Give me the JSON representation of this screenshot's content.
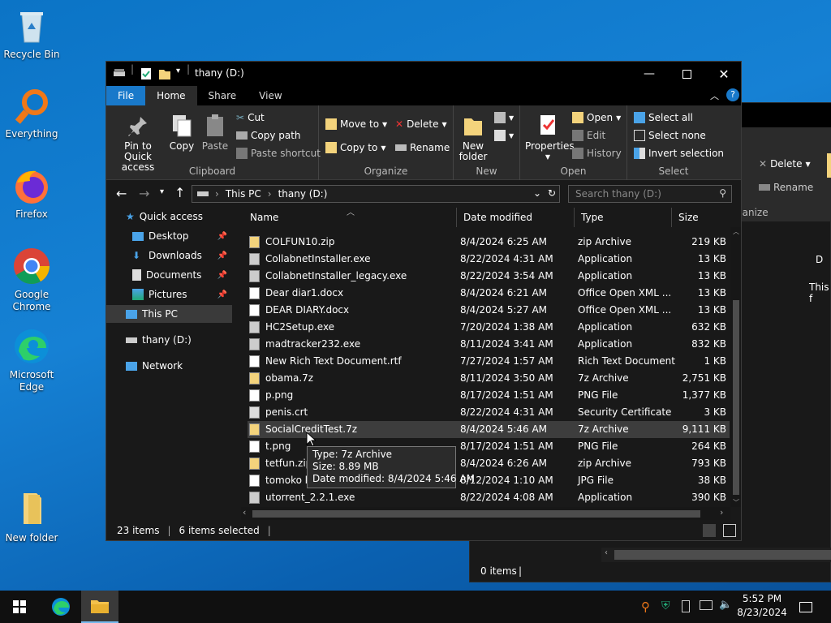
{
  "desktop": {
    "icons": [
      {
        "label": "Recycle Bin"
      },
      {
        "label": "Everything"
      },
      {
        "label": "Firefox"
      },
      {
        "label": "Google Chrome"
      },
      {
        "label": "Microsoft Edge"
      },
      {
        "label": "New folder"
      }
    ]
  },
  "window": {
    "title": "thany (D:)",
    "tabs": [
      "File",
      "Home",
      "Share",
      "View"
    ],
    "ribbon": {
      "clipboard": {
        "label": "Clipboard",
        "pin": "Pin to Quick access",
        "copy": "Copy",
        "paste": "Paste",
        "cut": "Cut",
        "copy_path": "Copy path",
        "paste_shortcut": "Paste shortcut"
      },
      "organize": {
        "label": "Organize",
        "move_to": "Move to",
        "copy_to": "Copy to",
        "delete": "Delete",
        "rename": "Rename"
      },
      "new": {
        "label": "New",
        "new_folder": "New folder"
      },
      "open": {
        "label": "Open",
        "properties": "Properties",
        "open": "Open",
        "edit": "Edit",
        "history": "History"
      },
      "select": {
        "label": "Select",
        "select_all": "Select all",
        "select_none": "Select none",
        "invert": "Invert selection"
      }
    },
    "address": {
      "crumbs": [
        "This PC",
        "thany (D:)"
      ]
    },
    "search": {
      "placeholder": "Search thany (D:)"
    },
    "nav": {
      "quick_access": "Quick access",
      "items": [
        "Desktop",
        "Downloads",
        "Documents",
        "Pictures"
      ],
      "this_pc": "This PC",
      "drive": "thany (D:)",
      "network": "Network"
    },
    "columns": {
      "name": "Name",
      "date": "Date modified",
      "type": "Type",
      "size": "Size"
    },
    "files": [
      {
        "name": "COLFUN10.zip",
        "date": "8/4/2024 6:25 AM",
        "type": "zip Archive",
        "size": "219 KB"
      },
      {
        "name": "CollabnetInstaller.exe",
        "date": "8/22/2024 4:31 AM",
        "type": "Application",
        "size": "13 KB"
      },
      {
        "name": "CollabnetInstaller_legacy.exe",
        "date": "8/22/2024 3:54 AM",
        "type": "Application",
        "size": "13 KB"
      },
      {
        "name": "Dear diar1.docx",
        "date": "8/4/2024 6:21 AM",
        "type": "Office Open XML ...",
        "size": "13 KB"
      },
      {
        "name": "DEAR DIARY.docx",
        "date": "8/4/2024 5:27 AM",
        "type": "Office Open XML ...",
        "size": "13 KB"
      },
      {
        "name": "HC2Setup.exe",
        "date": "7/20/2024 1:38 AM",
        "type": "Application",
        "size": "632 KB"
      },
      {
        "name": "madtracker232.exe",
        "date": "8/11/2024 3:41 AM",
        "type": "Application",
        "size": "832 KB"
      },
      {
        "name": "New Rich Text Document.rtf",
        "date": "7/27/2024 1:57 AM",
        "type": "Rich Text Document",
        "size": "1 KB"
      },
      {
        "name": "obama.7z",
        "date": "8/11/2024 3:50 AM",
        "type": "7z Archive",
        "size": "2,751 KB"
      },
      {
        "name": "p.png",
        "date": "8/17/2024 1:51 AM",
        "type": "PNG File",
        "size": "1,377 KB"
      },
      {
        "name": "penis.crt",
        "date": "8/22/2024 4:31 AM",
        "type": "Security Certificate",
        "size": "3 KB"
      },
      {
        "name": "SocialCreditTest.7z",
        "date": "8/4/2024 5:46 AM",
        "type": "7z Archive",
        "size": "9,111 KB"
      },
      {
        "name": "t.png",
        "date": "8/17/2024 1:51 AM",
        "type": "PNG File",
        "size": "264 KB"
      },
      {
        "name": "tetfun.zip",
        "date": "8/4/2024 6:26 AM",
        "type": "zip Archive",
        "size": "793 KB"
      },
      {
        "name": "tomoko k",
        "date": "8/12/2024 1:10 AM",
        "type": "JPG File",
        "size": "38 KB"
      },
      {
        "name": "utorrent_2.2.1.exe",
        "date": "8/22/2024 4:08 AM",
        "type": "Application",
        "size": "390 KB"
      }
    ],
    "tooltip": {
      "type": "Type: 7z Archive",
      "size": "Size: 8.89 MB",
      "date": "Date modified: 8/4/2024 5:46 AM"
    },
    "status": {
      "count": "23 items",
      "selected": "6 items selected"
    }
  },
  "back_window": {
    "delete": "Delete",
    "rename": "Rename",
    "organize": "ganize",
    "this_f": "This f",
    "status": "0 items"
  },
  "taskbar": {
    "time": "5:52 PM",
    "date": "8/23/2024"
  }
}
